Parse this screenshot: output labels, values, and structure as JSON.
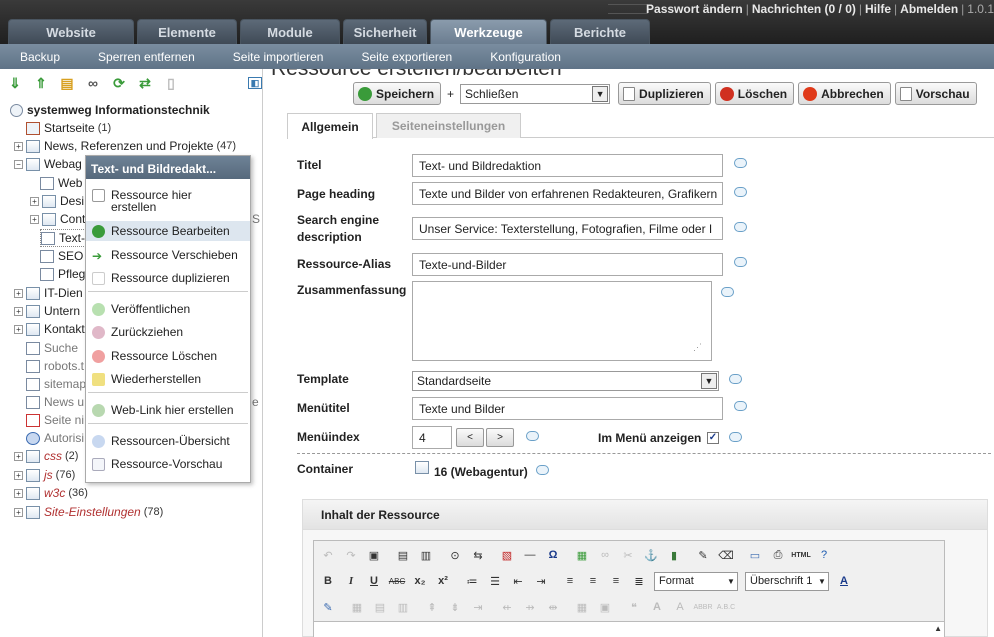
{
  "colors": {
    "accent": "#5f7387",
    "tab_active": "#7b8da0",
    "success": "#3a9b3a",
    "danger": "#d03020"
  },
  "header": {
    "tabs": [
      {
        "label": "Website"
      },
      {
        "label": "Elemente"
      },
      {
        "label": "Module"
      },
      {
        "label": "Sicherheit"
      },
      {
        "label": "Werkzeuge",
        "active": true
      },
      {
        "label": "Berichte"
      }
    ],
    "links": [
      {
        "label": "Passwort ändern"
      },
      {
        "label": "Nachrichten (0 / 0)"
      },
      {
        "label": "Hilfe"
      },
      {
        "label": "Abmelden"
      },
      {
        "label": "1.0.1"
      }
    ],
    "subnav": [
      {
        "label": "Backup"
      },
      {
        "label": "Sperren entfernen"
      },
      {
        "label": "Seite importieren"
      },
      {
        "label": "Seite exportieren"
      },
      {
        "label": "Konfiguration"
      }
    ]
  },
  "tree": {
    "root": "systemweg Informationstechnik",
    "items": [
      {
        "label": "Startseite",
        "count": "(1)"
      },
      {
        "label": "News, Referenzen und Projekte",
        "count": "(47)"
      },
      {
        "label": "Webag"
      },
      {
        "label": "Web"
      },
      {
        "label": "Desi"
      },
      {
        "label": "Cont"
      },
      {
        "label": "Text-"
      },
      {
        "label": "SEO"
      },
      {
        "label": "Pfleg"
      },
      {
        "label": "IT-Dien"
      },
      {
        "label": "Untern"
      },
      {
        "label": "Kontakt"
      },
      {
        "label": "Suche"
      },
      {
        "label": "robots.t"
      },
      {
        "label": "sitemap"
      },
      {
        "label": "News u"
      },
      {
        "label": "Seite ni"
      },
      {
        "label": "Autorisi"
      },
      {
        "label": "css",
        "count": "(2)"
      },
      {
        "label": "js",
        "count": "(76)"
      },
      {
        "label": "w3c",
        "count": "(36)"
      },
      {
        "label": "Site-Einstellungen",
        "count": "(78)"
      }
    ],
    "cutoff_chars": [
      {
        "label": "S"
      },
      {
        "label": "e"
      }
    ]
  },
  "context_menu": {
    "title": "Text- und Bildredakt...",
    "items": [
      {
        "label": "Ressource hier erstellen"
      },
      {
        "label": "Ressource Bearbeiten"
      },
      {
        "label": "Ressource Verschieben"
      },
      {
        "label": "Ressource duplizieren"
      },
      {
        "label": "Veröffentlichen"
      },
      {
        "label": "Zurückziehen"
      },
      {
        "label": "Ressource Löschen"
      },
      {
        "label": "Wiederherstellen"
      },
      {
        "label": "Web-Link hier erstellen"
      },
      {
        "label": "Ressourcen-Übersicht"
      },
      {
        "label": "Ressource-Vorschau"
      }
    ]
  },
  "main": {
    "title": "Ressource erstellen/bearbeiten",
    "actions": {
      "save": "Speichern",
      "plus": "+",
      "after_save": "Schließen",
      "duplicate": "Duplizieren",
      "delete": "Löschen",
      "cancel": "Abbrechen",
      "preview": "Vorschau"
    },
    "tabs": [
      {
        "label": "Allgemein",
        "active": true
      },
      {
        "label": "Seiteneinstellungen"
      }
    ],
    "fields": {
      "title_label": "Titel",
      "title_value": "Text- und Bildredaktion",
      "heading_label": "Page heading",
      "heading_value": "Texte und Bilder von erfahrenen Redakteuren, Grafikern",
      "sed_label": "Search engine description",
      "sed_value": "Unser Service: Texterstellung, Fotografien, Filme oder I",
      "alias_label": "Ressource-Alias",
      "alias_value": "Texte-und-Bilder",
      "summary_label": "Zusammenfassung",
      "summary_value": "",
      "template_label": "Template",
      "template_value": "Standardseite",
      "menutitle_label": "Menütitel",
      "menutitle_value": "Texte und Bilder",
      "menuindex_label": "Menüindex",
      "menuindex_value": "4",
      "dec": "<",
      "inc": ">",
      "inmenu_label": "Im Menü anzeigen",
      "inmenu_checked": true,
      "container_label": "Container",
      "container_value": "16 (Webagentur)"
    },
    "content": {
      "header": "Inhalt der Ressource",
      "format": "Format",
      "heading_select": "Überschrift 1"
    }
  }
}
